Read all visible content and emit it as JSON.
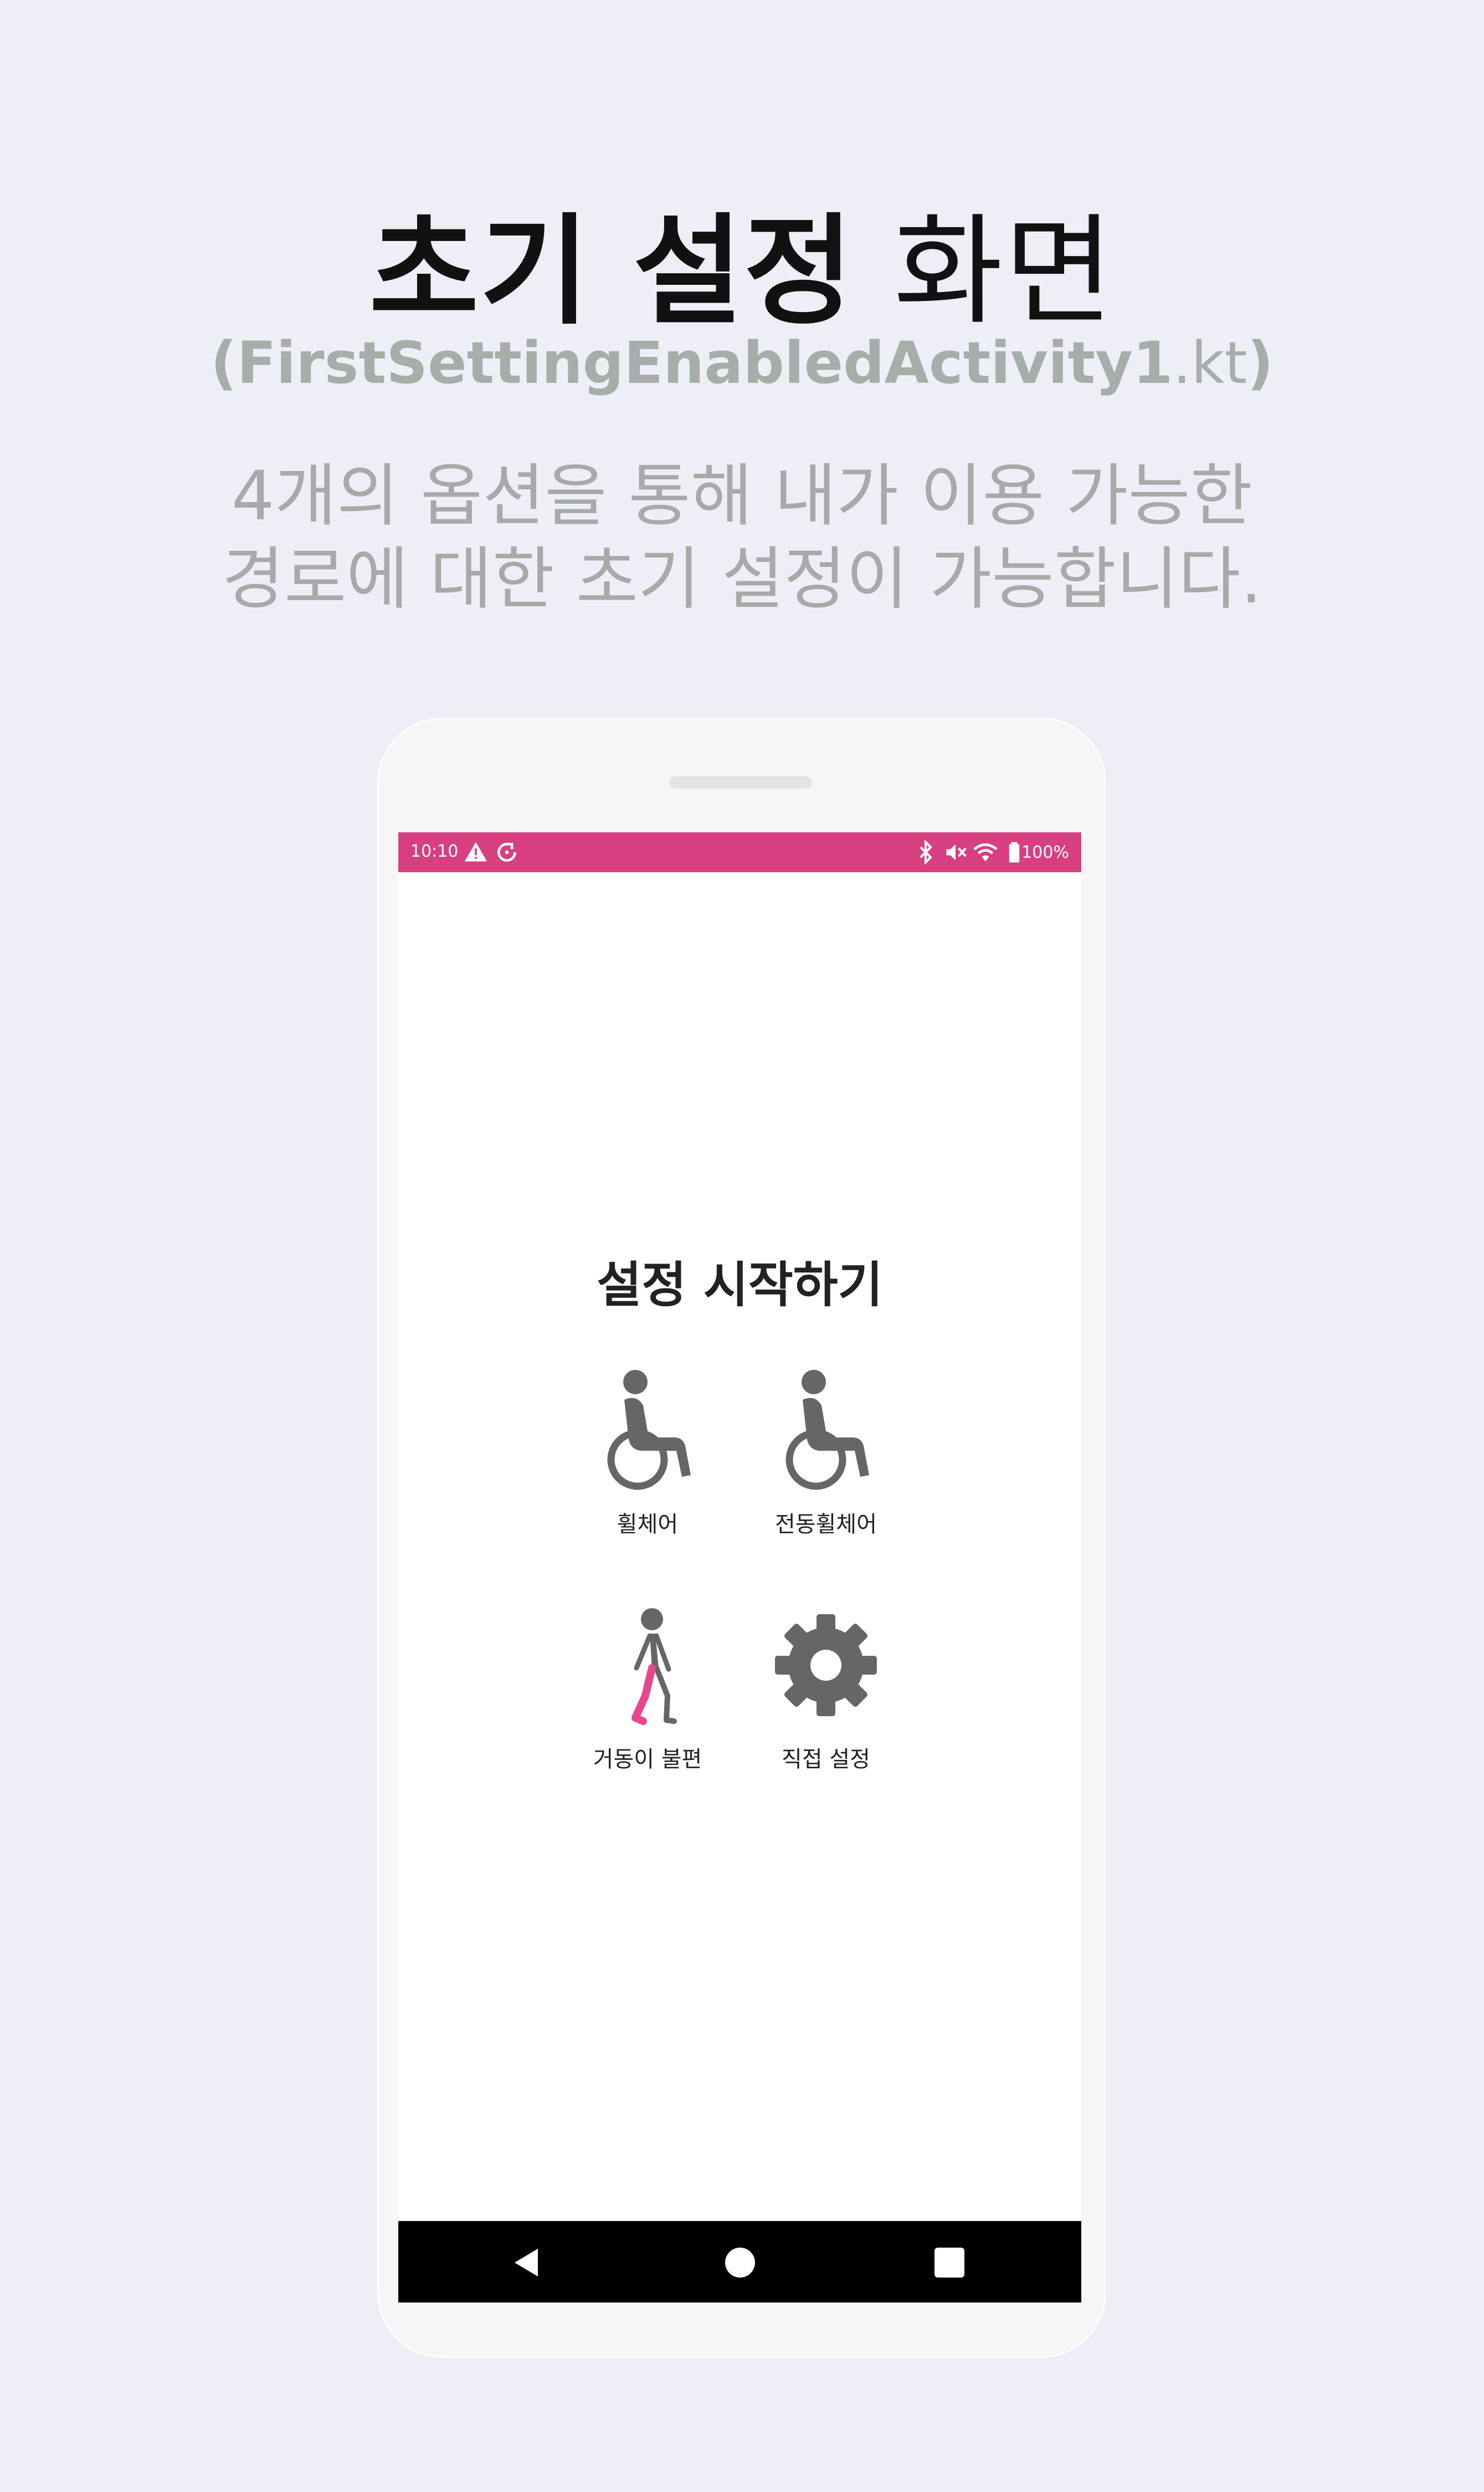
{
  "header": {
    "title_bold": "초기 설정",
    "title_normal": "화면",
    "subtitle_bold": "(FirstSettingEnabledActivity1",
    "subtitle_normal": ".kt",
    "subtitle_close": ")",
    "description_line1": "4개의 옵션을 통해 내가 이용 가능한",
    "description_line2": "경로에 대한 초기 설정이 가능합니다."
  },
  "status_bar": {
    "time": "10:10",
    "battery": "100%",
    "left_icons": [
      "warning-icon",
      "sync-icon"
    ],
    "right_icons": [
      "bluetooth-icon",
      "mute-icon",
      "wifi-icon",
      "battery-icon"
    ]
  },
  "screen": {
    "title": "설정 시작하기",
    "options": [
      {
        "label": "휠체어",
        "icon": "wheelchair-icon"
      },
      {
        "label": "전동휠체어",
        "icon": "electric-wheelchair-icon"
      },
      {
        "label": "거동이 불편",
        "icon": "walking-impaired-icon"
      },
      {
        "label": "직접 설정",
        "icon": "gear-icon"
      }
    ]
  },
  "nav_bar": {
    "buttons": [
      "back-icon",
      "home-icon",
      "recents-icon"
    ]
  },
  "colors": {
    "background": "#eeeff6",
    "status_bar": "#d83f80",
    "accent_pink": "#e8478e",
    "icon_gray": "#666666",
    "subtitle_gray": "#a7aeaa"
  }
}
